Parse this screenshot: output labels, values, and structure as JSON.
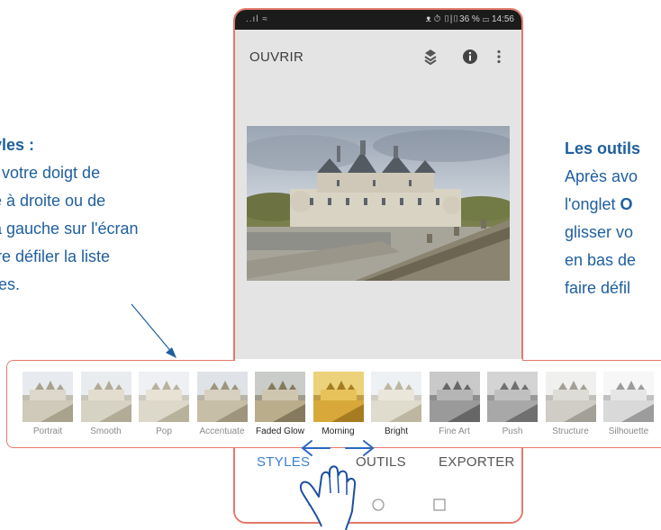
{
  "annotation_left": {
    "title": "yles :",
    "lines": [
      "t votre doigt de",
      "e à droite ou de",
      "à gauche sur l'écran",
      "ire défiler la liste",
      "res."
    ]
  },
  "annotation_right": {
    "title": "Les outils",
    "line1": "Après avo",
    "line2_prefix": "l'onglet ",
    "line2_bold": "O",
    "line3": "glisser vo",
    "line4": "en bas de",
    "line5": "faire défil"
  },
  "status_bar": {
    "left": "..ıl ≈",
    "right": "ᴥ ⏱ ▯|▯36 % ▭ 14:56"
  },
  "toolbar": {
    "open_label": "OUVRIR",
    "icons": [
      "layers-icon",
      "info-icon",
      "more-vert-icon"
    ]
  },
  "filters": [
    {
      "label": "Portrait"
    },
    {
      "label": "Smooth"
    },
    {
      "label": "Pop"
    },
    {
      "label": "Accentuate"
    },
    {
      "label": "Faded Glow"
    },
    {
      "label": "Morning"
    },
    {
      "label": "Bright"
    },
    {
      "label": "Fine Art"
    },
    {
      "label": "Push"
    },
    {
      "label": "Structure"
    },
    {
      "label": "Silhouette"
    }
  ],
  "tabs": {
    "styles": "STYLES",
    "outils": "OUTILS",
    "exporter": "EXPORTER"
  },
  "colors": {
    "accent": "#3d7fd6",
    "frame": "#e4796b",
    "annotation_text": "#1f5f9e"
  }
}
